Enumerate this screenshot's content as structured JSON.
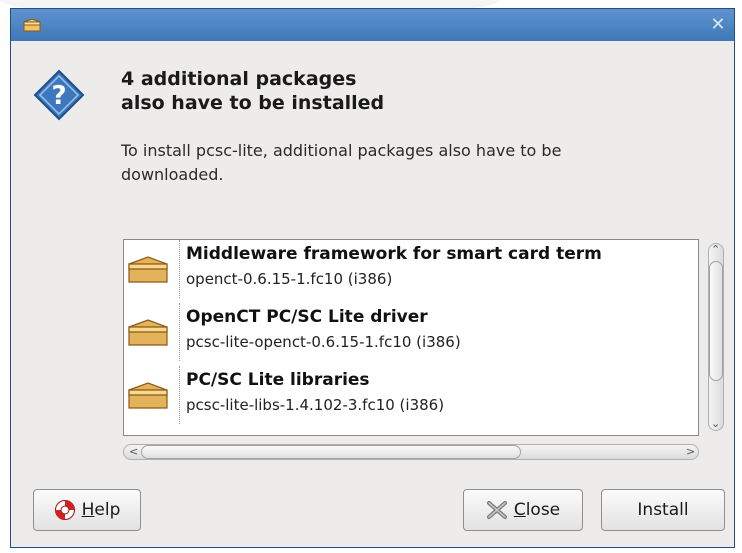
{
  "dialog": {
    "heading": "4 additional packages also have to be installed",
    "heading_line1": "4 additional packages",
    "heading_line2": "also have to be installed",
    "description_line1": "To install pcsc-lite, additional packages also have to be",
    "description_line2": "downloaded."
  },
  "packages": [
    {
      "summary": "Middleware framework for smart card term",
      "version": "openct-0.6.15-1.fc10 (i386)"
    },
    {
      "summary": "OpenCT PC/SC Lite driver",
      "version": "pcsc-lite-openct-0.6.15-1.fc10 (i386)"
    },
    {
      "summary": "PC/SC Lite libraries",
      "version": "pcsc-lite-libs-1.4.102-3.fc10 (i386)"
    }
  ],
  "buttons": {
    "help_mnemonic": "H",
    "help_rest": "elp",
    "close_mnemonic": "C",
    "close_rest": "lose",
    "install": "Install"
  },
  "icons": {
    "titlebar": "package-icon",
    "question": "question-icon",
    "close": "close-icon",
    "help": "lifebuoy-icon",
    "close_button": "close-x-icon"
  },
  "colors": {
    "titlebar": "#4a82c2",
    "question_icon": "#3d78be",
    "package_icon": "#d9a84a"
  }
}
